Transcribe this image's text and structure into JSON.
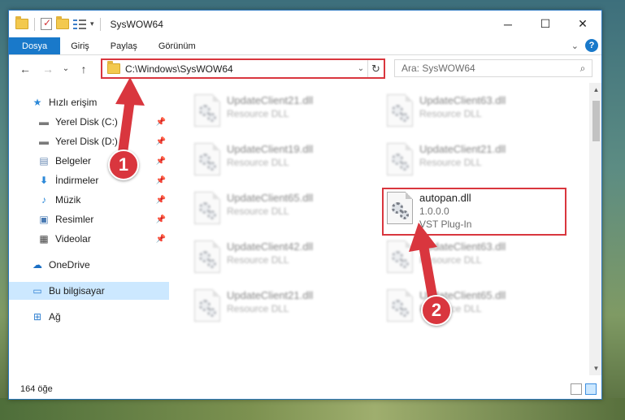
{
  "window": {
    "title": "SysWOW64",
    "controls": {
      "minimize": "─",
      "maximize": "☐",
      "close": "✕"
    }
  },
  "ribbon": {
    "tabs": [
      {
        "label": "Dosya"
      },
      {
        "label": "Giriş"
      },
      {
        "label": "Paylaş"
      },
      {
        "label": "Görünüm"
      }
    ],
    "help": "?"
  },
  "address": {
    "path": "C:\\Windows\\SysWOW64",
    "search_placeholder": "Ara: SysWOW64"
  },
  "nav": {
    "items": [
      {
        "label": "Hızlı erişim",
        "icon": "star-icon"
      },
      {
        "label": "Yerel Disk (C:)",
        "icon": "drive-icon"
      },
      {
        "label": "Yerel Disk (D:)",
        "icon": "drive-icon"
      },
      {
        "label": "Belgeler",
        "icon": "documents-icon"
      },
      {
        "label": "İndirmeler",
        "icon": "download-icon"
      },
      {
        "label": "Müzik",
        "icon": "music-icon"
      },
      {
        "label": "Resimler",
        "icon": "pictures-icon"
      },
      {
        "label": "Videolar",
        "icon": "video-icon"
      },
      {
        "label": "OneDrive",
        "icon": "cloud-icon"
      },
      {
        "label": "Bu bilgisayar",
        "icon": "computer-icon"
      },
      {
        "label": "Ağ",
        "icon": "network-icon"
      }
    ]
  },
  "files": [
    {
      "name": "UpdateClient21.dll",
      "sub": "Resource DLL"
    },
    {
      "name": "UpdateClient63.dll",
      "sub": "Resource DLL"
    },
    {
      "name": "UpdateClient19.dll",
      "sub": "Resource DLL"
    },
    {
      "name": "UpdateClient21.dll",
      "sub": "Resource DLL"
    },
    {
      "name": "UpdateClient65.dll",
      "sub": "Resource DLL"
    },
    {
      "name": "autopan.dll",
      "version": "1.0.0.0",
      "sub": "VST Plug-In"
    },
    {
      "name": "UpdateClient42.dll",
      "sub": "Resource DLL"
    },
    {
      "name": "UpdateClient63.dll",
      "sub": "Resource DLL"
    },
    {
      "name": "UpdateClient21.dll",
      "sub": "Resource DLL"
    },
    {
      "name": "UpdateClient65.dll",
      "sub": "Resource DLL"
    }
  ],
  "status": {
    "count": "164 öğe"
  },
  "annotations": {
    "step1": "1",
    "step2": "2",
    "color": "#d9363e"
  }
}
